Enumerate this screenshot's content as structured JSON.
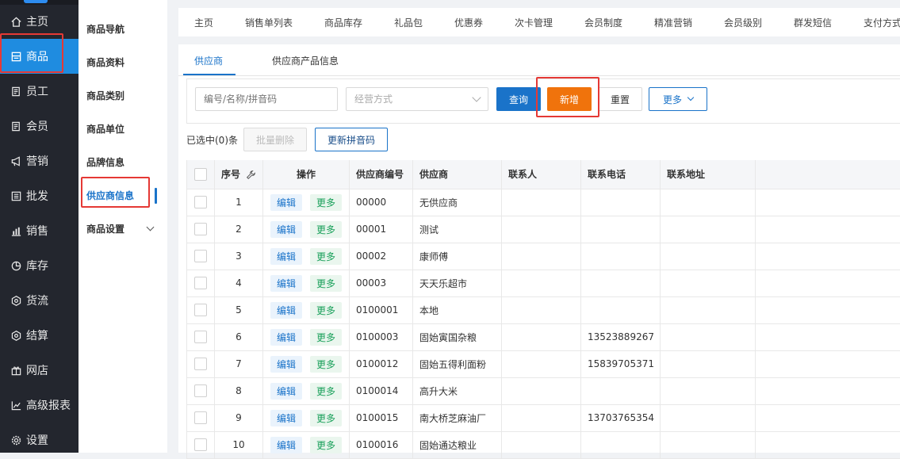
{
  "nav": {
    "items": [
      {
        "label": "主页",
        "icon": "home-icon"
      },
      {
        "label": "商品",
        "icon": "product-icon"
      },
      {
        "label": "员工",
        "icon": "staff-icon"
      },
      {
        "label": "会员",
        "icon": "member-icon"
      },
      {
        "label": "营销",
        "icon": "megaphone-icon"
      },
      {
        "label": "批发",
        "icon": "wholesale-icon"
      },
      {
        "label": "销售",
        "icon": "bar-chart-icon"
      },
      {
        "label": "库存",
        "icon": "pie-chart-icon"
      },
      {
        "label": "货流",
        "icon": "gear-icon"
      },
      {
        "label": "结算",
        "icon": "gear-icon"
      },
      {
        "label": "网店",
        "icon": "gift-icon"
      },
      {
        "label": "高级报表",
        "icon": "line-chart-icon"
      },
      {
        "label": "设置",
        "icon": "settings-icon"
      }
    ],
    "active": "商品"
  },
  "subnav": {
    "items": [
      "商品导航",
      "商品资料",
      "商品类别",
      "商品单位",
      "品牌信息",
      "供应商信息",
      "商品设置"
    ],
    "active": "供应商信息"
  },
  "topnav": {
    "tabs": [
      "主页",
      "销售单列表",
      "商品库存",
      "礼品包",
      "优惠券",
      "次卡管理",
      "会员制度",
      "精准营销",
      "会员级别",
      "群发短信",
      "支付方式"
    ]
  },
  "subtabs": [
    "供应商",
    "供应商产品信息"
  ],
  "filter": {
    "search_placeholder": "编号/名称/拼音码",
    "mode_placeholder": "经营方式",
    "query_label": "查询",
    "add_label": "新增",
    "reset_label": "重置",
    "more_label": "更多"
  },
  "selection": {
    "count_text": "已选中(0)条",
    "batch_delete_label": "批量删除",
    "update_pinyin_label": "更新拼音码"
  },
  "table": {
    "columns": [
      "序号",
      "操作",
      "供应商编号",
      "供应商",
      "联系人",
      "联系电话",
      "联系地址"
    ],
    "edit_label": "编辑",
    "more_label": "更多",
    "rows": [
      {
        "no": "1",
        "code": "00000",
        "name": "无供应商",
        "contact": "",
        "phone": "",
        "address": ""
      },
      {
        "no": "2",
        "code": "00001",
        "name": "测试",
        "contact": "",
        "phone": "",
        "address": ""
      },
      {
        "no": "3",
        "code": "00002",
        "name": "康师傅",
        "contact": "",
        "phone": "",
        "address": ""
      },
      {
        "no": "4",
        "code": "00003",
        "name": "天天乐超市",
        "contact": "",
        "phone": "",
        "address": ""
      },
      {
        "no": "5",
        "code": "0100001",
        "name": "本地",
        "contact": "",
        "phone": "",
        "address": ""
      },
      {
        "no": "6",
        "code": "0100003",
        "name": "固始寅国杂粮",
        "contact": "",
        "phone": "13523889267",
        "address": ""
      },
      {
        "no": "7",
        "code": "0100012",
        "name": "固始五得利面粉",
        "contact": "",
        "phone": "15839705371",
        "address": ""
      },
      {
        "no": "8",
        "code": "0100014",
        "name": "高升大米",
        "contact": "",
        "phone": "",
        "address": ""
      },
      {
        "no": "9",
        "code": "0100015",
        "name": "南大桥芝麻油厂",
        "contact": "",
        "phone": "13703765354",
        "address": ""
      },
      {
        "no": "10",
        "code": "0100016",
        "name": "固始通达粮业",
        "contact": "",
        "phone": "",
        "address": ""
      }
    ]
  },
  "colors": {
    "accent": "#1a73c9",
    "orange": "#f0730c",
    "nav_bg": "#23262e",
    "nav_active": "#1f8ce0",
    "highlight": "#e53935"
  }
}
